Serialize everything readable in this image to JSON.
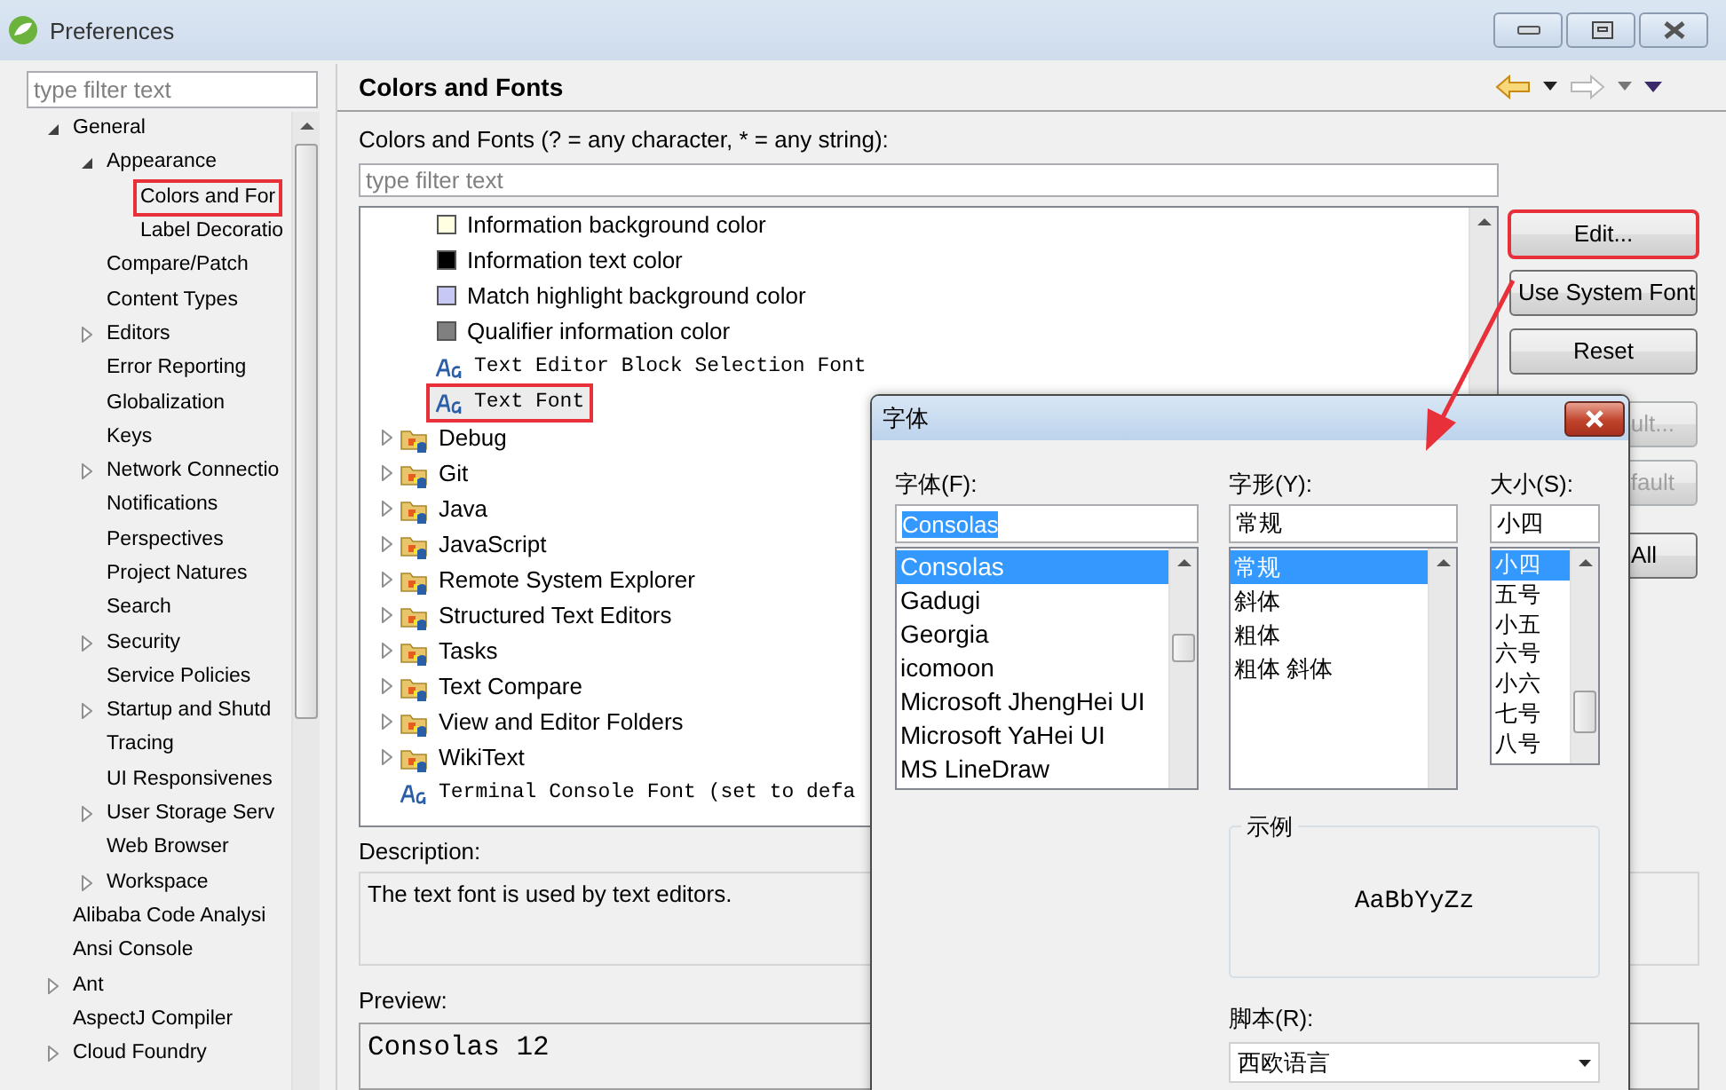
{
  "window": {
    "title": "Preferences"
  },
  "sidebar": {
    "filter": {
      "placeholder": "type filter text"
    },
    "tree": [
      {
        "label": "General",
        "expanded": true,
        "children": [
          {
            "label": "Appearance",
            "expanded": true,
            "children": [
              {
                "label": "Colors and For",
                "annotated": true
              },
              {
                "label": "Label Decoratio"
              }
            ]
          },
          {
            "label": "Compare/Patch"
          },
          {
            "label": "Content Types"
          },
          {
            "label": "Editors",
            "expanded": false
          },
          {
            "label": "Error Reporting"
          },
          {
            "label": "Globalization"
          },
          {
            "label": "Keys"
          },
          {
            "label": "Network Connectio",
            "expanded": false
          },
          {
            "label": "Notifications"
          },
          {
            "label": "Perspectives"
          },
          {
            "label": "Project Natures"
          },
          {
            "label": "Search"
          },
          {
            "label": "Security",
            "expanded": false
          },
          {
            "label": "Service Policies"
          },
          {
            "label": "Startup and Shutd",
            "expanded": false
          },
          {
            "label": "Tracing"
          },
          {
            "label": "UI Responsivenes"
          },
          {
            "label": "User Storage Serv",
            "expanded": false
          },
          {
            "label": "Web Browser"
          },
          {
            "label": "Workspace",
            "expanded": false
          }
        ]
      },
      {
        "label": "Alibaba Code Analysi"
      },
      {
        "label": "Ansi Console"
      },
      {
        "label": "Ant",
        "expanded": false
      },
      {
        "label": "AspectJ Compiler"
      },
      {
        "label": "Cloud Foundry",
        "expanded": false
      }
    ]
  },
  "page": {
    "title": "Colors and Fonts",
    "filter_label": "Colors and Fonts (? = any character, * = any string):",
    "filter": {
      "placeholder": "type filter text"
    },
    "tree": [
      {
        "kind": "continued",
        "children": [
          {
            "kind": "color",
            "label": "Information background color",
            "color": "#ffffe1",
            "selected": false
          },
          {
            "kind": "color",
            "label": "Information text color",
            "color": "#000000",
            "selected": false
          },
          {
            "kind": "color",
            "label": "Match highlight background color",
            "color": "#c8c8f5",
            "selected": false
          },
          {
            "kind": "color",
            "label": "Qualifier information color",
            "color": "#808080",
            "selected": false
          },
          {
            "kind": "font",
            "label": "Text Editor Block Selection Font",
            "selected": false
          },
          {
            "kind": "font",
            "label": "Text Font",
            "selected": true,
            "annotated": true
          }
        ]
      },
      {
        "kind": "category",
        "label": "Debug",
        "expanded": false,
        "selected": false
      },
      {
        "kind": "category",
        "label": "Git",
        "expanded": false,
        "selected": false
      },
      {
        "kind": "category",
        "label": "Java",
        "expanded": false,
        "selected": false
      },
      {
        "kind": "category",
        "label": "JavaScript",
        "expanded": false,
        "selected": false
      },
      {
        "kind": "category",
        "label": "Remote System Explorer",
        "expanded": false,
        "selected": false
      },
      {
        "kind": "category",
        "label": "Structured Text Editors",
        "expanded": false,
        "selected": false
      },
      {
        "kind": "category",
        "label": "Tasks",
        "expanded": false,
        "selected": false
      },
      {
        "kind": "category",
        "label": "Text Compare",
        "expanded": false,
        "selected": false
      },
      {
        "kind": "category",
        "label": "View and Editor Folders",
        "expanded": false,
        "selected": false
      },
      {
        "kind": "category",
        "label": "WikiText",
        "expanded": false,
        "selected": false
      },
      {
        "kind": "font",
        "label": "Terminal Console Font (set to defa",
        "selected": false
      }
    ],
    "buttons": [
      {
        "label": "Edit...",
        "annotated": true,
        "disabled": false
      },
      {
        "label": "Use System Font",
        "disabled": false
      },
      {
        "label": "Reset",
        "disabled": false
      },
      {
        "label": "ult...",
        "disabled": true
      },
      {
        "label": "fault",
        "disabled": true
      },
      {
        "label": "All",
        "disabled": false
      }
    ],
    "description": {
      "label": "Description:",
      "text": "The text font is used by text editors."
    },
    "preview": {
      "label": "Preview:",
      "text": "Consolas 12"
    }
  },
  "font_dialog": {
    "title": "字体",
    "font": {
      "label": "字体(F):",
      "value": "Consolas",
      "value_selected": true,
      "items": [
        {
          "label": "Consolas",
          "selected": true
        },
        {
          "label": "Gadugi",
          "selected": false
        },
        {
          "label": "Georgia",
          "selected": false
        },
        {
          "label": "icomoon",
          "selected": false
        },
        {
          "label": "Microsoft JhengHei UI",
          "selected": false
        },
        {
          "label": "Microsoft YaHei UI",
          "selected": false
        },
        {
          "label": "MS LineDraw",
          "selected": false
        }
      ]
    },
    "style": {
      "label": "字形(Y):",
      "value": "常规",
      "value_selected": false,
      "items": [
        {
          "label": "常规",
          "selected": true
        },
        {
          "label": "斜体",
          "selected": false
        },
        {
          "label": "粗体",
          "selected": false
        },
        {
          "label": "粗体 斜体",
          "selected": false
        }
      ]
    },
    "size": {
      "label": "大小(S):",
      "value": "小四",
      "value_selected": false,
      "items": [
        {
          "label": "小四",
          "selected": true
        },
        {
          "label": "五号",
          "selected": false
        },
        {
          "label": "小五",
          "selected": false
        },
        {
          "label": "六号",
          "selected": false
        },
        {
          "label": "小六",
          "selected": false
        },
        {
          "label": "七号",
          "selected": false
        },
        {
          "label": "八号",
          "selected": false
        }
      ]
    },
    "sample": {
      "label": "示例",
      "text": "AaBbYyZz"
    },
    "script": {
      "label": "脚本(R):",
      "value": "西欧语言"
    }
  }
}
